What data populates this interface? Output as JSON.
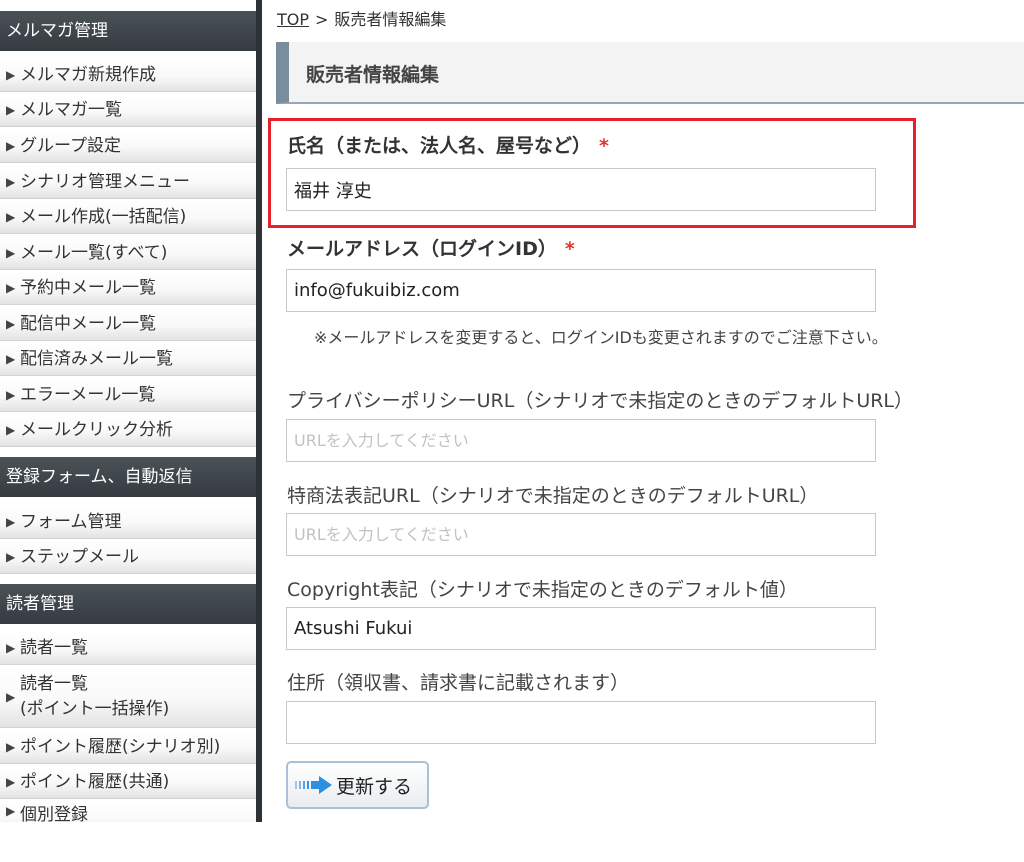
{
  "sidebar": {
    "sections": [
      {
        "header": "メルマガ管理",
        "items": [
          {
            "label": "メルマガ新規作成"
          },
          {
            "label": "メルマガ一覧"
          },
          {
            "label": "グループ設定"
          },
          {
            "label": "シナリオ管理メニュー"
          },
          {
            "label": "メール作成(一括配信)"
          },
          {
            "label": "メール一覧(すべて)"
          },
          {
            "label": "予約中メール一覧"
          },
          {
            "label": "配信中メール一覧"
          },
          {
            "label": "配信済みメール一覧"
          },
          {
            "label": "エラーメール一覧"
          },
          {
            "label": "メールクリック分析"
          }
        ]
      },
      {
        "header": "登録フォーム、自動返信",
        "items": [
          {
            "label": "フォーム管理"
          },
          {
            "label": "ステップメール"
          }
        ]
      },
      {
        "header": "読者管理",
        "items": [
          {
            "label": "読者一覧"
          },
          {
            "label_line1": "読者一覧",
            "label_line2": "(ポイント一括操作)"
          },
          {
            "label": "ポイント履歴(シナリオ別)"
          },
          {
            "label": "ポイント履歴(共通)"
          },
          {
            "label": "個別登録"
          }
        ]
      }
    ],
    "arrow_glyph": "▶"
  },
  "breadcrumb": {
    "home": "TOP",
    "separator": ">",
    "current": "販売者情報編集"
  },
  "page_title": "販売者情報編集",
  "form": {
    "name": {
      "label": "氏名（または、法人名、屋号など）",
      "required_mark": "*",
      "value": "福井 淳史"
    },
    "email": {
      "label": "メールアドレス（ログインID）",
      "required_mark": "*",
      "value": "info@fukuibiz.com",
      "note": "※メールアドレスを変更すると、ログインIDも変更されますのでご注意下さい。"
    },
    "privacy_url": {
      "label": "プライバシーポリシーURL（シナリオで未指定のときのデフォルトURL）",
      "value": "",
      "placeholder": "URLを入力してください"
    },
    "tokusho_url": {
      "label": "特商法表記URL（シナリオで未指定のときのデフォルトURL）",
      "value": "",
      "placeholder": "URLを入力してください"
    },
    "copyright": {
      "label": "Copyright表記（シナリオで未指定のときのデフォルト値）",
      "value": "Atsushi Fukui"
    },
    "address": {
      "label": "住所（領収書、請求書に記載されます）",
      "value": ""
    },
    "submit_label": "更新する"
  },
  "colors": {
    "sidebar_header": "#3d4449",
    "highlight_border": "#e4212c",
    "required": "#e0342f",
    "button_arrow": "#2f8ee0"
  }
}
